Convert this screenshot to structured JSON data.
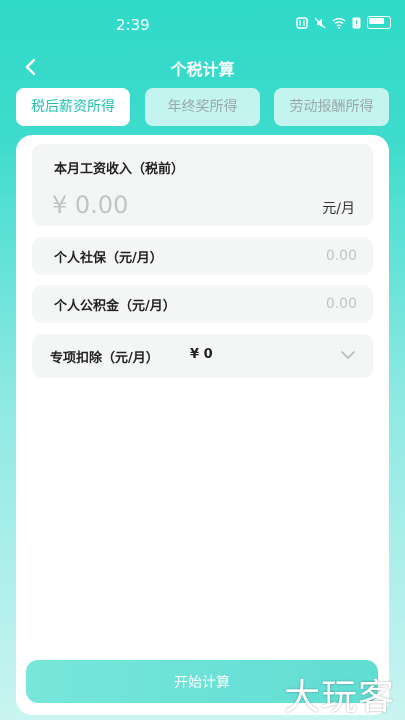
{
  "status_bar": {
    "time": "2:39"
  },
  "nav": {
    "title": "个税计算"
  },
  "tabs": [
    {
      "label": "税后薪资所得",
      "active": true
    },
    {
      "label": "年终奖所得",
      "active": false
    },
    {
      "label": "劳动报酬所得",
      "active": false
    }
  ],
  "income": {
    "label": "本月工资收入（税前）",
    "placeholder": "¥ 0.00",
    "unit": "元/月"
  },
  "social_insurance": {
    "label": "个人社保（元/月）",
    "placeholder": "0.00"
  },
  "housing_fund": {
    "label": "个人公积金（元/月）",
    "placeholder": "0.00"
  },
  "deduction": {
    "label": "专项扣除（元/月）",
    "value": "¥ 0"
  },
  "start_button": {
    "label": "开始计算"
  },
  "watermark": {
    "text": "大玩客"
  },
  "colors": {
    "accent": "#1fbfb0",
    "gradient_top": "#2fd9c8",
    "button": "#6fe2d8"
  }
}
